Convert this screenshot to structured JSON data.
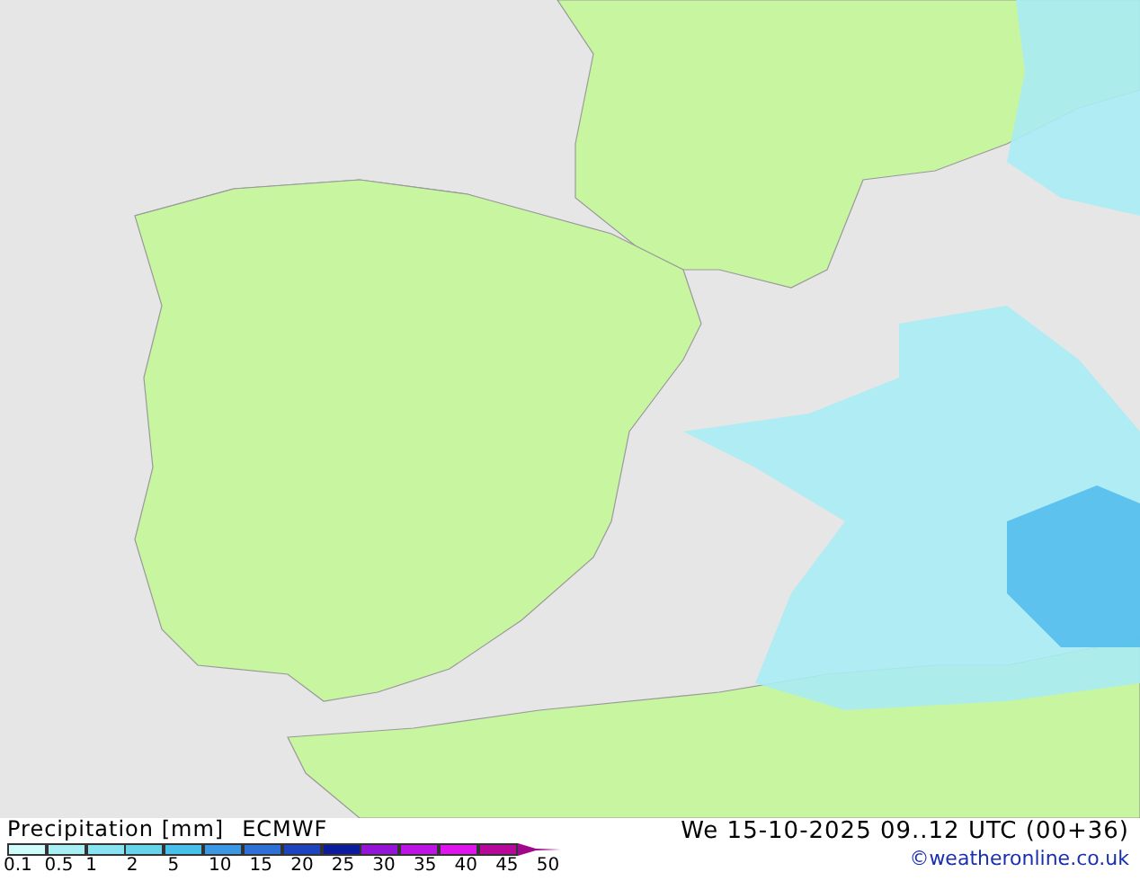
{
  "legend": {
    "title": "Precipitation [mm]",
    "model": "ECMWF",
    "bins": [
      {
        "color": "#d0fcfc"
      },
      {
        "color": "#a8f0f4"
      },
      {
        "color": "#88e4f0"
      },
      {
        "color": "#68d4ec"
      },
      {
        "color": "#48c0ec"
      },
      {
        "color": "#3c98e4"
      },
      {
        "color": "#2c70d8"
      },
      {
        "color": "#1c44c0"
      },
      {
        "color": "#0c1c9c"
      },
      {
        "color": "#9414d8"
      },
      {
        "color": "#bc14e4"
      },
      {
        "color": "#e014ec"
      },
      {
        "color": "#b8089c"
      }
    ],
    "labels": [
      "0.1",
      "0.5",
      "1",
      "2",
      "5",
      "10",
      "15",
      "20",
      "25",
      "30",
      "35",
      "40",
      "45",
      "50"
    ]
  },
  "valid_time": "We 15-10-2025 09..12 UTC (00+36)",
  "credit": "©weatheronline.co.uk"
}
